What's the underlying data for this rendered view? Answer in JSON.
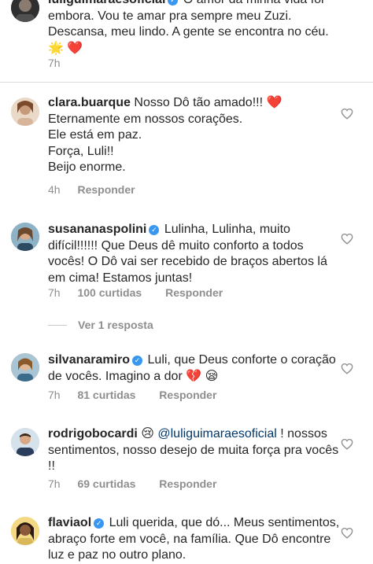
{
  "comments": [
    {
      "username": "luliguimaraesoficial",
      "verified": true,
      "text": "O amor da minha vida foi embora. Vou te amar pra sempre meu Zuzi. Descansa, meu lindo. A gente se encontra no céu. 🌟 ❤️",
      "time": "7h"
    },
    {
      "username": "clara.buarque",
      "verified": false,
      "text_lines": [
        "Nosso Dô tão amado!!! ❤️",
        "Eternamente em nossos corações.",
        "Ele está em paz.",
        "Força, Luli!!",
        "Beijo enorme."
      ],
      "time": "4h",
      "reply_label": "Responder"
    },
    {
      "username": "susananaspolini",
      "verified": true,
      "text": "Lulinha, Lulinha, muito difícil!!!!!! Que Deus dê muito conforto a todos vocês! O Dô vai ser recebido de braços abertos lá em cima! Estamos juntas!",
      "time": "7h",
      "likes": "100 curtidas",
      "reply_label": "Responder",
      "view_replies": "Ver 1 resposta"
    },
    {
      "username": "silvanaramiro",
      "verified": true,
      "text": "Luli, que Deus conforte o coração de vocês. Imagino a dor 💔 😪",
      "time": "7h",
      "likes": "81 curtidas",
      "reply_label": "Responder"
    },
    {
      "username": "rodrigobocardi",
      "verified": false,
      "emoji": "😢",
      "mention": "@luliguimaraesoficial",
      "text": "! nossos sentimentos, nosso desejo de muita força pra vocês !!",
      "time": "7h",
      "likes": "69 curtidas",
      "reply_label": "Responder"
    },
    {
      "username": "flaviaol",
      "verified": true,
      "text": "Luli querida, que dó... Meus sentimentos, abraço forte em você, na família. Que Dô encontre luz e paz no outro plano."
    }
  ],
  "icons": {
    "like": "heart-outline-icon",
    "verified": "verified-badge-icon"
  },
  "colors": {
    "verified": "#3897f0",
    "meta": "#8e8e8e",
    "mention": "#00376b"
  }
}
